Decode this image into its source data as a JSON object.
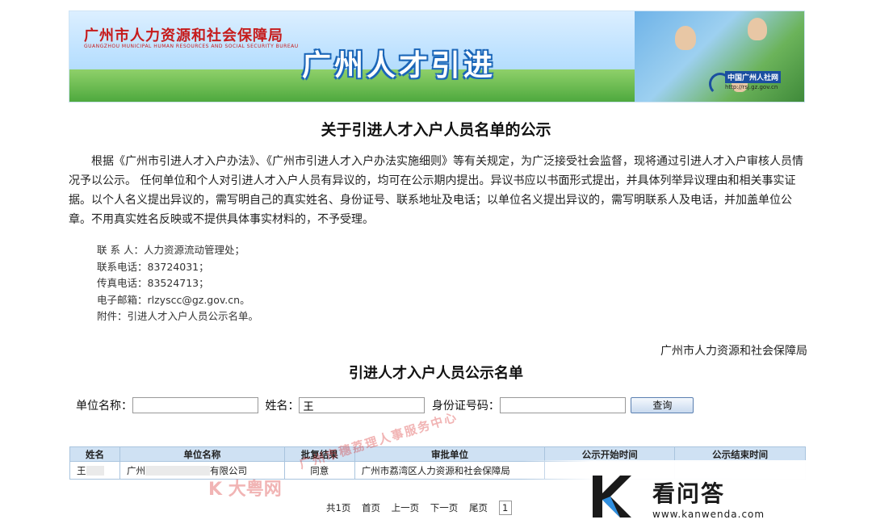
{
  "banner": {
    "org_cn": "广州市人力资源和社会保障局",
    "org_en": "GUANGZHOU MUNICIPAL HUMAN RESOURCES AND SOCIAL SECURITY BUREAU",
    "headline": "广州人才引进",
    "logo_text": "中国广州人社网",
    "logo_url": "http://rsj.gz.gov.cn"
  },
  "notice": {
    "title": "关于引进人才入户人员名单的公示",
    "body": "根据《广州市引进人才入户办法》、《广州市引进人才入户办法实施细则》等有关规定，为广泛接受社会监督，现将通过引进人才入户审核人员情况予以公示。 任何单位和个人对引进人才入户人员有异议的，均可在公示期内提出。异议书应以书面形式提出，并具体列举异议理由和相关事实证据。以个人名义提出异议的，需写明自己的真实姓名、身份证号、联系地址及电话；以单位名义提出异议的，需写明联系人及电话，并加盖单位公章。不用真实姓名反映或不提供具体事实材料的，不予受理。",
    "contacts": [
      "联 系 人：人力资源流动管理处；",
      "联系电话：83724031；",
      "传真电话：83524713；",
      "电子邮箱：rlzyscc@gz.gov.cn。",
      "附件：引进人才入户人员公示名单。"
    ],
    "signature": "广州市人力资源和社会保障局"
  },
  "list": {
    "title": "引进人才入户人员公示名单",
    "search": {
      "unit_label": "单位名称：",
      "unit_value": "",
      "name_label": "姓名：",
      "name_value": "王",
      "id_label": "身份证号码：",
      "id_value": "",
      "query_button": "查询"
    },
    "columns": [
      "姓名",
      "单位名称",
      "批复结果",
      "审批单位",
      "公示开始时间",
      "公示结束时间"
    ],
    "rows": [
      {
        "name": "王",
        "unit_prefix": "广州",
        "unit_suffix": "有限公司",
        "result": "同意",
        "approver": "广州市荔湾区人力资源和社会保障局",
        "start": "",
        "end": ""
      }
    ],
    "pager": {
      "total": "共1页",
      "first": "首页",
      "prev": "上一页",
      "next": "下一页",
      "last": "尾页",
      "current": "1"
    }
  },
  "watermarks": {
    "red_text": "广州市穗荔理人事服务中心",
    "red_logo": "K 大粤网",
    "brand": "看问答",
    "brand_url": "www.kanwenda.com"
  }
}
